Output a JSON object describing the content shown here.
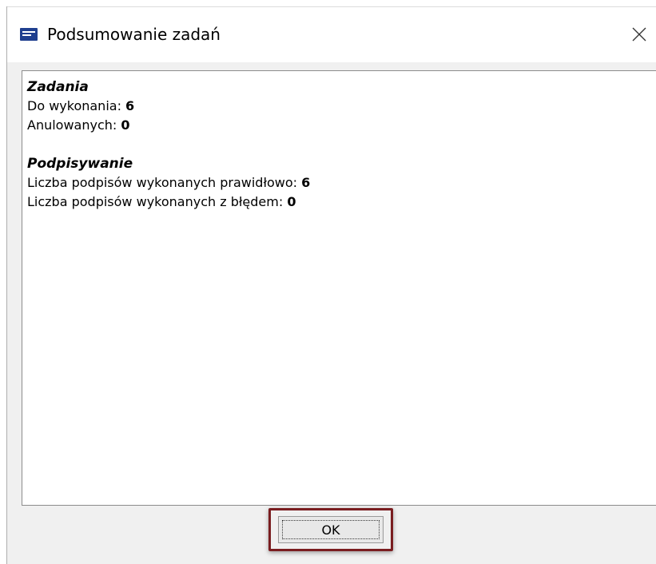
{
  "window": {
    "title": "Podsumowanie zadań",
    "app_icon": "app-logo-icon",
    "close_icon": "close-icon"
  },
  "summary": {
    "tasks": {
      "title": "Zadania",
      "to_do_label": "Do wykonania: ",
      "to_do_value": "6",
      "cancelled_label": "Anulowanych: ",
      "cancelled_value": "0"
    },
    "signing": {
      "title": "Podpisywanie",
      "ok_label": "Liczba podpisów wykonanych prawidłowo: ",
      "ok_value": "6",
      "error_label": "Liczba podpisów wykonanych z błędem: ",
      "error_value": "0"
    }
  },
  "footer": {
    "ok_label": "OK"
  },
  "colors": {
    "highlight_border": "#7a1d20",
    "icon_blue": "#1f3f8f"
  }
}
